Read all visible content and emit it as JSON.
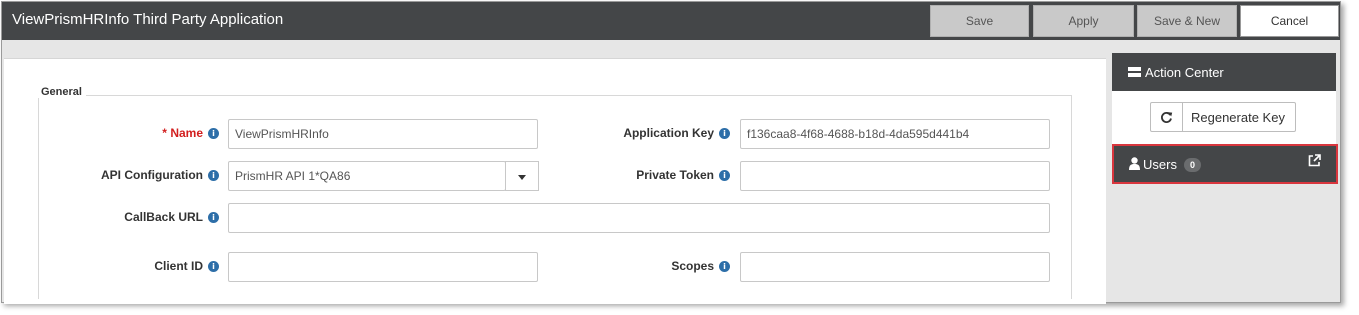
{
  "window": {
    "title": "ViewPrismHRInfo Third Party Application"
  },
  "toolbar": {
    "save_label": "Save",
    "apply_label": "Apply",
    "save_new_label": "Save & New",
    "cancel_label": "Cancel"
  },
  "form": {
    "section_title": "General",
    "required_marker": "*",
    "name": {
      "label": "Name",
      "value": "ViewPrismHRInfo"
    },
    "application_key": {
      "label": "Application Key",
      "value": "f136caa8-4f68-4688-b18d-4da595d441b4"
    },
    "api_configuration": {
      "label": "API Configuration",
      "value": "PrismHR API 1*QA86"
    },
    "private_token": {
      "label": "Private Token",
      "value": ""
    },
    "callback_url": {
      "label": "CallBack URL",
      "value": ""
    },
    "client_id": {
      "label": "Client ID",
      "value": ""
    },
    "scopes": {
      "label": "Scopes",
      "value": ""
    },
    "info_glyph": "i"
  },
  "action_center": {
    "title": "Action Center",
    "regenerate_label": "Regenerate Key",
    "users_label": "Users",
    "users_count": "0"
  },
  "colors": {
    "dark_header": "#444648",
    "required": "#d21f1f",
    "info_icon": "#2d6ea8",
    "highlight_border": "#d9363e"
  }
}
